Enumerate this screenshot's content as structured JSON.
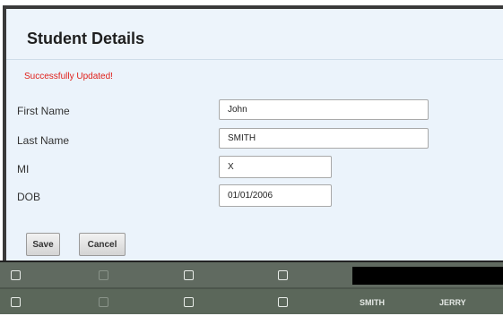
{
  "dialog": {
    "title": "Student Details",
    "status_message": "Successfully Updated!",
    "fields": [
      {
        "label": "First Name",
        "value": "John"
      },
      {
        "label": "Last Name",
        "value": "SMITH"
      },
      {
        "label": "MI",
        "value": "X"
      },
      {
        "label": "DOB",
        "value": "01/01/2006"
      }
    ],
    "buttons": {
      "save": "Save",
      "cancel": "Cancel"
    }
  },
  "grid": {
    "rows": [
      {
        "last_name": "",
        "first_name": ""
      },
      {
        "last_name": "SMITH",
        "first_name": "JERRY"
      }
    ]
  },
  "colors": {
    "dialog_bg": "#ebf3fb",
    "status_text": "#e0201a",
    "grid_bg": "#606a60"
  }
}
